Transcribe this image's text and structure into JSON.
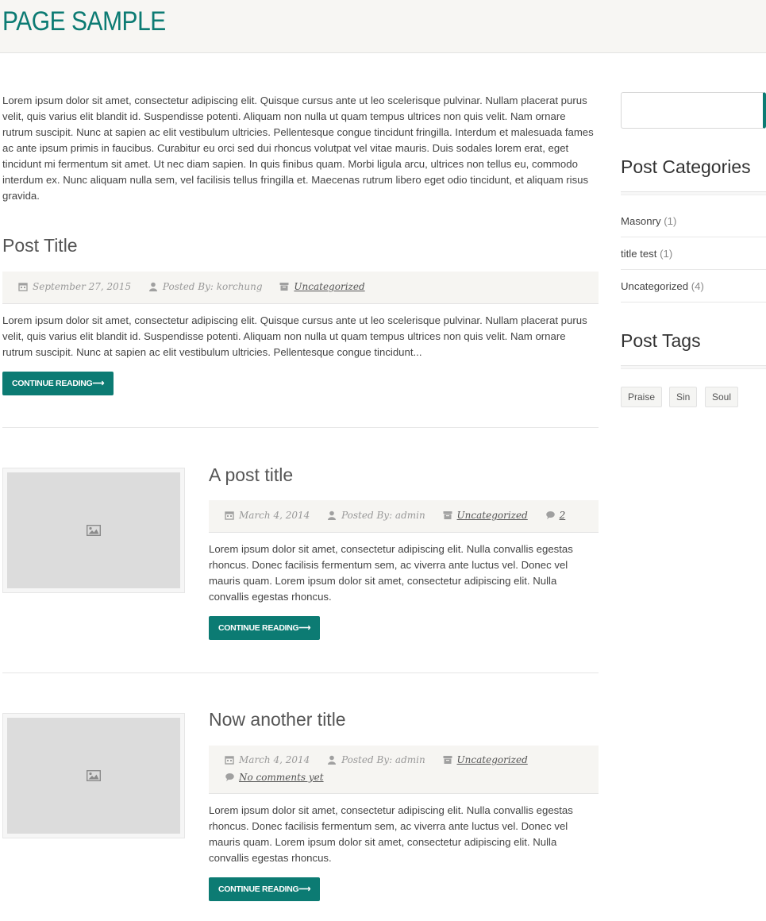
{
  "page": {
    "title": "PAGE SAMPLE"
  },
  "intro": "Lorem ipsum dolor sit amet, consectetur adipiscing elit. Quisque cursus ante ut leo scelerisque pulvinar. Nullam placerat purus velit, quis varius elit blandit id. Suspendisse potenti. Aliquam non nulla ut quam tempus ultrices non quis velit. Nam ornare rutrum suscipit. Nunc at sapien ac elit vestibulum ultricies. Pellentesque congue tincidunt fringilla. Interdum et malesuada fames ac ante ipsum primis in faucibus. Curabitur eu orci sed dui rhoncus volutpat vel vitae mauris. Duis sodales lorem erat, eget tincidunt mi fermentum sit amet. Ut nec diam sapien. In quis finibus quam. Morbi ligula arcu, ultrices non tellus eu, commodo interdum ex. Nunc aliquam nulla sem, vel facilisis tellus fringilla et. Maecenas rutrum libero eget odio tincidunt, et aliquam risus gravida.",
  "posts": [
    {
      "title": "Post Title",
      "date": "September 27, 2015",
      "author": "Posted By: korchung",
      "category": "Uncategorized",
      "excerpt": "Lorem ipsum dolor sit amet, consectetur adipiscing elit. Quisque cursus ante ut leo scelerisque pulvinar. Nullam placerat purus velit, quis varius elit blandit id. Suspendisse potenti. Aliquam non nulla ut quam tempus ultrices non quis velit. Nam ornare rutrum suscipit. Nunc at sapien ac elit vestibulum ultricies. Pellentesque congue tincidunt...",
      "button": "CONTINUE READING⟶"
    },
    {
      "title": "A post title",
      "date": "March 4, 2014",
      "author": "Posted By: admin",
      "category": "Uncategorized",
      "comments": "2",
      "excerpt": "Lorem ipsum dolor sit amet, consectetur adipiscing elit. Nulla convallis egestas rhoncus. Donec facilisis fermentum sem, ac viverra ante luctus vel. Donec vel mauris quam. Lorem ipsum dolor sit amet, consectetur adipiscing elit. Nulla convallis egestas rhoncus.",
      "button": "CONTINUE READING⟶"
    },
    {
      "title": "Now another title",
      "date": "March 4, 2014",
      "author": "Posted By: admin",
      "category": "Uncategorized",
      "comments": "No comments yet",
      "excerpt": "Lorem ipsum dolor sit amet, consectetur adipiscing elit. Nulla convallis egestas rhoncus. Donec facilisis fermentum sem, ac viverra ante luctus vel. Donec vel mauris quam. Lorem ipsum dolor sit amet, consectetur adipiscing elit. Nulla convallis egestas rhoncus.",
      "button": "CONTINUE READING⟶"
    }
  ],
  "sidebar": {
    "categories_title": "Post Categories",
    "categories": [
      {
        "label": "Masonry",
        "count": "(1)"
      },
      {
        "label": "title test",
        "count": "(1)"
      },
      {
        "label": "Uncategorized",
        "count": "(4)"
      }
    ],
    "tags_title": "Post Tags",
    "tags": [
      "Praise",
      "Sin",
      "Soul"
    ]
  },
  "colors": {
    "accent": "#0c7b73",
    "meta_bg": "#f6f5f2",
    "header_bg": "#f7f6f3"
  }
}
